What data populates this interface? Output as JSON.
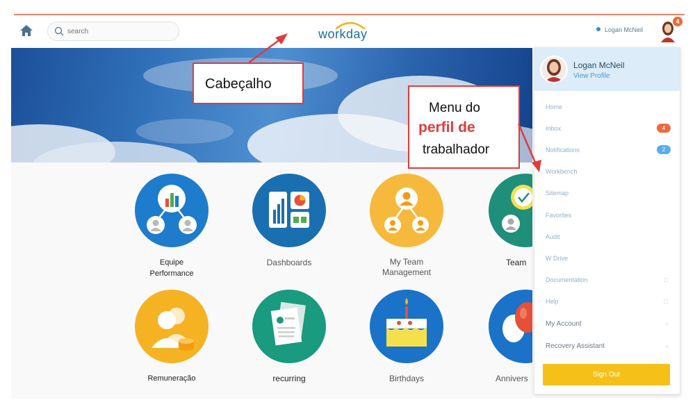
{
  "header": {
    "search_placeholder": "search",
    "logo_text": "workday",
    "user_name": "Logan McNeil",
    "notification_count": "4"
  },
  "callouts": {
    "header_label": "Cabeçalho",
    "menu_line1": "Menu do",
    "menu_line2": "perfil de",
    "menu_line3": "trabalhador"
  },
  "apps": [
    {
      "line1": "Equipe",
      "line2": "Performance"
    },
    {
      "line1": "Dashboards",
      "line2": ""
    },
    {
      "line1": "My Team",
      "line2": "Management"
    },
    {
      "line1": "Team",
      "line2": ""
    },
    {
      "line1": "Remuneração",
      "line2": ""
    },
    {
      "line1": "recurring",
      "line2": ""
    },
    {
      "line1": "Birthdays",
      "line2": ""
    },
    {
      "line1": "Annivers",
      "line2": ""
    }
  ],
  "profile_menu": {
    "name": "Logan McNeil",
    "view_profile": "View Profile",
    "items": [
      {
        "label": "Home"
      },
      {
        "label": "Inbox",
        "badge": "4"
      },
      {
        "label": "Notifications",
        "badge": "2"
      },
      {
        "label": "Workbench"
      },
      {
        "label": "Sitemap"
      },
      {
        "label": "Favorites"
      },
      {
        "label": "Audit"
      },
      {
        "label": "W Drive"
      },
      {
        "label": "Documentation"
      },
      {
        "label": "Help"
      },
      {
        "label": "My Account"
      },
      {
        "label": "Recovery Assistant"
      }
    ],
    "sign_out": "Sign Out"
  },
  "colors": {
    "accent_red": "#e03b3b",
    "workday_blue": "#1a6fa8",
    "signout_yellow": "#f5c018",
    "badge_orange": "#ee6a3a",
    "badge_blue": "#5aaee8"
  }
}
